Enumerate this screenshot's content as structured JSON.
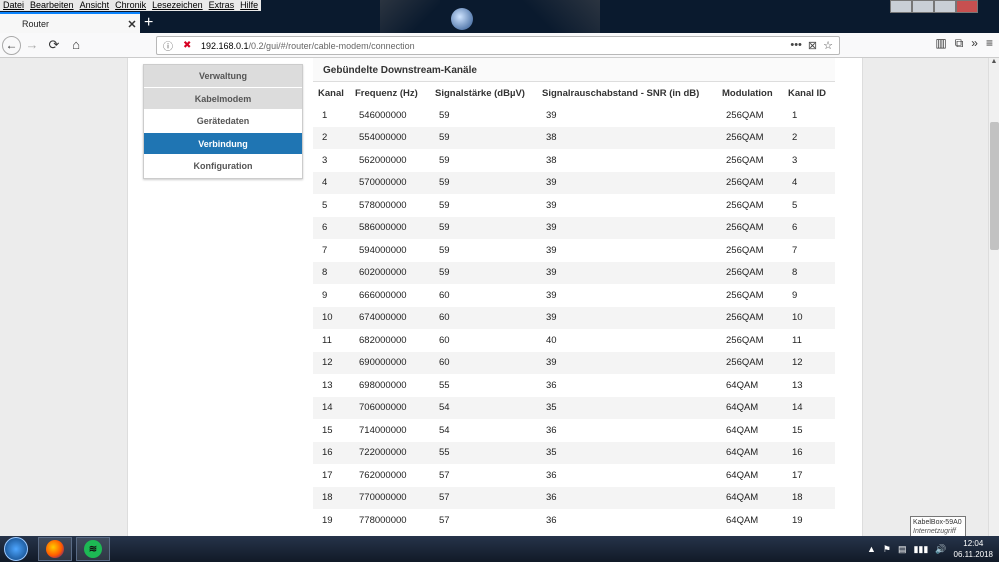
{
  "menubar": [
    "Datei",
    "Bearbeiten",
    "Ansicht",
    "Chronik",
    "Lesezeichen",
    "Extras",
    "Hilfe"
  ],
  "tab": {
    "title": "Router",
    "close": "✕"
  },
  "newtab_icon": "+",
  "nav": {
    "back_icon": "←",
    "forward_icon": "→",
    "reload_icon": "⟳",
    "home_icon": "⌂"
  },
  "url": {
    "host": "192.168.0.1",
    "path": "/0.2/gui/#/router/cable-modem/connection",
    "info_icon": "ⓘ",
    "actions": [
      "•••",
      "⊠",
      "☆"
    ]
  },
  "toolbar_right": [
    "▥",
    "⧉",
    "»",
    "≡"
  ],
  "sidemenu": [
    {
      "label": "Verwaltung",
      "state": "grey"
    },
    {
      "label": "Kabelmodem",
      "state": "grey"
    },
    {
      "label": "Gerätedaten",
      "state": ""
    },
    {
      "label": "Verbindung",
      "state": "active"
    },
    {
      "label": "Konfiguration",
      "state": ""
    }
  ],
  "panel": {
    "title": "Gebündelte Downstream-Kanäle",
    "columns": [
      "Kanal",
      "Frequenz (Hz)",
      "Signalstärke (dBµV)",
      "Signalrauschabstand - SNR (in dB)",
      "Modulation",
      "Kanal ID"
    ],
    "rows": [
      [
        "1",
        "546000000",
        "59",
        "39",
        "256QAM",
        "1"
      ],
      [
        "2",
        "554000000",
        "59",
        "38",
        "256QAM",
        "2"
      ],
      [
        "3",
        "562000000",
        "59",
        "38",
        "256QAM",
        "3"
      ],
      [
        "4",
        "570000000",
        "59",
        "39",
        "256QAM",
        "4"
      ],
      [
        "5",
        "578000000",
        "59",
        "39",
        "256QAM",
        "5"
      ],
      [
        "6",
        "586000000",
        "59",
        "39",
        "256QAM",
        "6"
      ],
      [
        "7",
        "594000000",
        "59",
        "39",
        "256QAM",
        "7"
      ],
      [
        "8",
        "602000000",
        "59",
        "39",
        "256QAM",
        "8"
      ],
      [
        "9",
        "666000000",
        "60",
        "39",
        "256QAM",
        "9"
      ],
      [
        "10",
        "674000000",
        "60",
        "39",
        "256QAM",
        "10"
      ],
      [
        "11",
        "682000000",
        "60",
        "40",
        "256QAM",
        "11"
      ],
      [
        "12",
        "690000000",
        "60",
        "39",
        "256QAM",
        "12"
      ],
      [
        "13",
        "698000000",
        "55",
        "36",
        "64QAM",
        "13"
      ],
      [
        "14",
        "706000000",
        "54",
        "35",
        "64QAM",
        "14"
      ],
      [
        "15",
        "714000000",
        "54",
        "36",
        "64QAM",
        "15"
      ],
      [
        "16",
        "722000000",
        "55",
        "35",
        "64QAM",
        "16"
      ],
      [
        "17",
        "762000000",
        "57",
        "36",
        "64QAM",
        "17"
      ],
      [
        "18",
        "770000000",
        "57",
        "36",
        "64QAM",
        "18"
      ],
      [
        "19",
        "778000000",
        "57",
        "36",
        "64QAM",
        "19"
      ]
    ]
  },
  "taskbar": {
    "clock_time": "12:04",
    "clock_date": "06.11.2018",
    "tray_icons": [
      "▲",
      "⚑",
      "▤",
      "▮▮▮",
      "🔊"
    ]
  },
  "tooltip": {
    "title": "KabelBox-59A0",
    "subtitle": "Internetzugriff"
  },
  "colors": {
    "accent": "#1f75b3",
    "taskbar": "#1a2536"
  }
}
